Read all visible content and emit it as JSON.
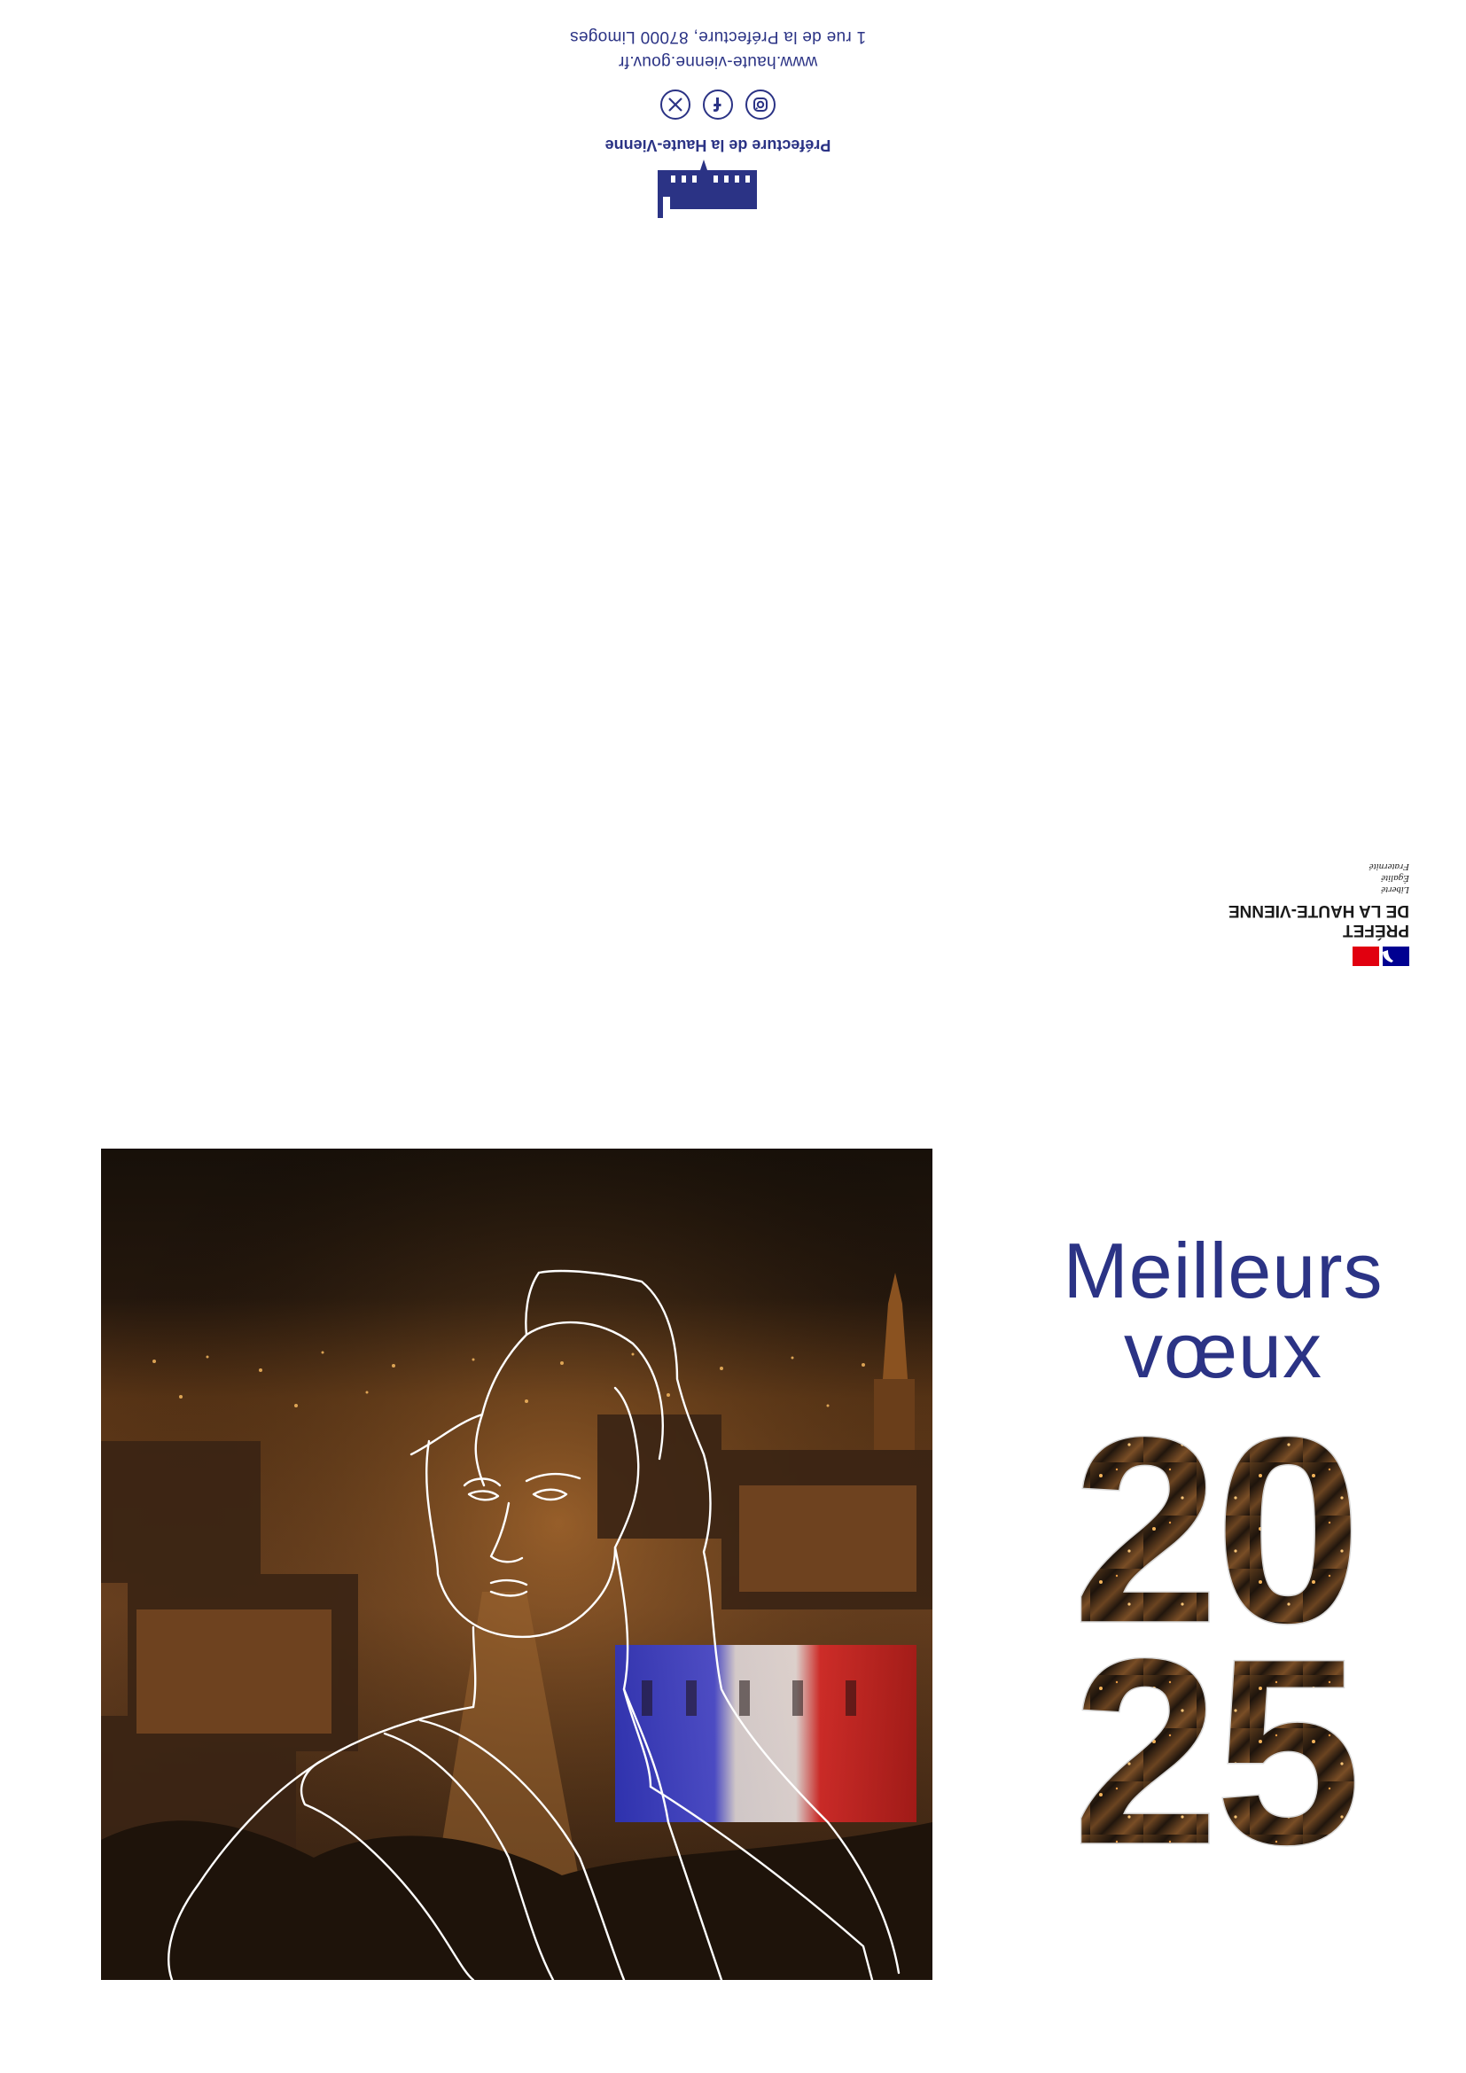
{
  "contact": {
    "address": "1 rue de la Préfecture, 87000 Limoges",
    "website": "www.haute-vienne.gouv.fr",
    "organization": "Préfecture de la Haute-Vienne",
    "socials": [
      "instagram-icon",
      "facebook-icon",
      "x-icon"
    ]
  },
  "marianne": {
    "title_line1": "PRÉFET",
    "title_line2": "DE LA HAUTE-VIENNE",
    "motto": [
      "Liberté",
      "Égalité",
      "Fraternité"
    ]
  },
  "greeting": {
    "line1": "Meilleurs",
    "line2": "vœux"
  },
  "year": {
    "top": "20",
    "bottom": "25"
  },
  "colors": {
    "navy": "#2b3385",
    "flag_blue": "#000091",
    "flag_red": "#e1000f"
  }
}
